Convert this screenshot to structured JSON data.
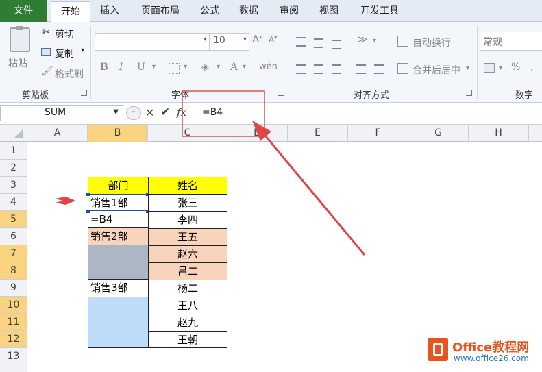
{
  "ribbon": {
    "tabs": [
      "文件",
      "开始",
      "插入",
      "页面布局",
      "公式",
      "数据",
      "审阅",
      "视图",
      "开发工具"
    ],
    "clipboard": {
      "paste": "粘贴",
      "cut": "剪切",
      "copy": "复制",
      "format_painter": "格式刷",
      "label": "剪贴板"
    },
    "font": {
      "size": "10",
      "label": "字体"
    },
    "alignment": {
      "wrap_text": "自动换行",
      "merge_center": "合并后居中",
      "label": "对齐方式"
    },
    "number": {
      "format": "常规",
      "label": "数字"
    }
  },
  "formula_bar": {
    "name_box": "SUM",
    "fx": "fx",
    "formula": "=B4"
  },
  "columns": [
    "A",
    "B",
    "C",
    "D",
    "E",
    "F",
    "G",
    "H"
  ],
  "rows": [
    "1",
    "2",
    "3",
    "4",
    "5",
    "6",
    "7",
    "8",
    "9",
    "10",
    "11",
    "12",
    "13"
  ],
  "table": {
    "header": {
      "b": "部门",
      "c": "姓名"
    },
    "b_values": {
      "r4": "销售1部",
      "r5": "=B4",
      "r6": "销售2部",
      "r9": "销售3部"
    },
    "c_values": [
      "张三",
      "李四",
      "王五",
      "赵六",
      "吕二",
      "杨二",
      "王八",
      "赵九",
      "王朝"
    ]
  },
  "watermark": {
    "brand": "Office教程网",
    "url": "www.office26.com"
  },
  "colors": {
    "header_yellow": "#ffff00",
    "orange_fill": "#f9d4bd",
    "grey_fill": "#adb7c4",
    "blue_fill": "#bcdcf9",
    "arrow_red": "#e04545",
    "selected_header": "#f9d37f"
  }
}
